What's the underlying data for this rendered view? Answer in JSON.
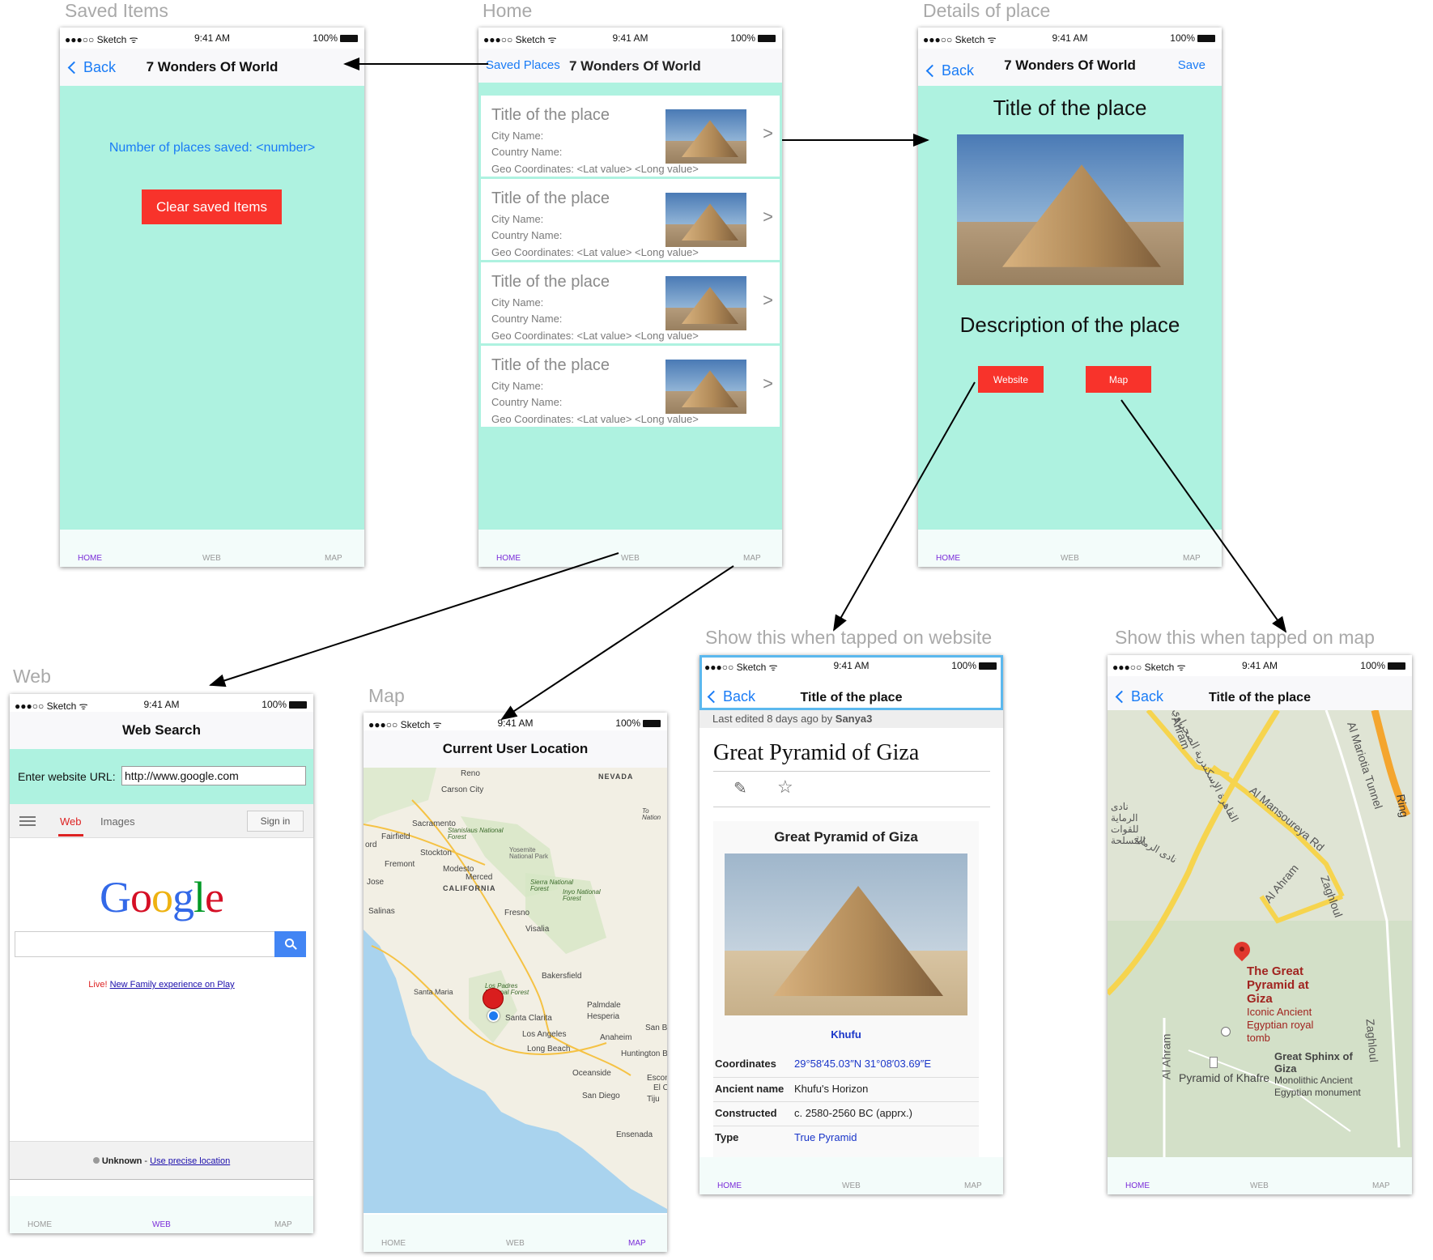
{
  "screens": {
    "saved": {
      "label": "Saved Items",
      "status": {
        "carrier": "●●●○○ Sketch ᯤ",
        "time": "9:41 AM",
        "battery": "100%"
      },
      "back": "Back",
      "title": "7 Wonders Of World",
      "count_text": "Number of places saved: <number>",
      "clear_button": "Clear saved Items"
    },
    "home": {
      "label": "Home",
      "status": {
        "carrier": "●●●○○ Sketch ᯤ",
        "time": "9:41 AM",
        "battery": "100%"
      },
      "saved_places": "Saved Places",
      "title": "7 Wonders Of World",
      "cards": [
        {
          "title": "Title of the place",
          "city": "City Name:",
          "country": "Country Name:",
          "geo": "Geo Coordinates: <Lat value> <Long value>",
          "arrow": ">"
        },
        {
          "title": "Title of the place",
          "city": "City Name:",
          "country": "Country Name:",
          "geo": "Geo Coordinates: <Lat value> <Long value>",
          "arrow": ">"
        },
        {
          "title": "Title of the place",
          "city": "City Name:",
          "country": "Country Name:",
          "geo": "Geo Coordinates: <Lat value> <Long value>",
          "arrow": ">"
        },
        {
          "title": "Title of the place",
          "city": "City Name:",
          "country": "Country Name:",
          "geo": "Geo Coordinates: <Lat value> <Long value>",
          "arrow": ">"
        }
      ]
    },
    "details": {
      "label": "Details of place",
      "status": {
        "carrier": "●●●○○ Sketch ᯤ",
        "time": "9:41 AM",
        "battery": "100%"
      },
      "back": "Back",
      "title": "7 Wonders Of World",
      "save": "Save",
      "place_title": "Title of the place",
      "description": "Description of the place",
      "website_button": "Website",
      "map_button": "Map"
    },
    "web": {
      "label": "Web",
      "status": {
        "carrier": "●●●○○ Sketch ᯤ",
        "time": "9:41 AM",
        "battery": "100%"
      },
      "title": "Web Search",
      "url_label": "Enter website URL:",
      "url_value": "http://www.google.com",
      "google": {
        "tab_web": "Web",
        "tab_images": "Images",
        "sign_in": "Sign in",
        "logo": "Google",
        "promo_live": "Live!",
        "promo_link": "New Family experience on Play",
        "location_unknown": "Unknown",
        "location_dash": " - ",
        "location_link": "Use precise location"
      }
    },
    "map": {
      "label": "Map",
      "status": {
        "carrier": "●●●○○ Sketch ᯤ",
        "time": "9:41 AM",
        "battery": "100%"
      },
      "title": "Current User Location",
      "places": [
        "Reno",
        "Carson City",
        "NEVADA",
        "Sacramento",
        "Fairfield",
        "Stanislaus National Forest",
        "Yosemite National Park",
        "Stockton",
        "Fremont",
        "Modesto",
        "Merced",
        "Jose",
        "CALIFORNIA",
        "Sierra National Forest",
        "Inyo National Forest",
        "Salinas",
        "Fresno",
        "Visalia",
        "Bakersfield",
        "Santa Maria",
        "Los Padres National Forest",
        "Palmdale",
        "Santa Clarita",
        "Hesperia",
        "San Ber",
        "Los Angeles",
        "Anaheim",
        "Long Beach",
        "Huntington Bea",
        "Oceanside",
        "Escon",
        "El C",
        "San Diego",
        "Tiju",
        "Ensenada",
        "To Nation",
        "ord"
      ]
    },
    "wiki": {
      "label": "Show this when tapped on website",
      "status": {
        "carrier": "●●●○○ Sketch ᯤ",
        "time": "9:41 AM",
        "battery": "100%"
      },
      "back": "Back",
      "title": "Title of the place",
      "edited_prefix": "Last edited 8 days ago by ",
      "edited_user": "Sanya3",
      "heading": "Great Pyramid of Giza",
      "infobox_title": "Great Pyramid of Giza",
      "caption": "Khufu",
      "rows": [
        {
          "k": "Coordinates",
          "v": "29°58′45.03″N 31°08′03.69″E"
        },
        {
          "k": "Ancient name",
          "v": "Khufu's Horizon"
        },
        {
          "k": "Constructed",
          "v": "c. 2580-2560 BC (apprx.)"
        },
        {
          "k": "Type",
          "v": "True Pyramid"
        }
      ]
    },
    "gmap": {
      "label": "Show this when tapped on map",
      "status": {
        "carrier": "●●●○○ Sketch ᯤ",
        "time": "9:41 AM",
        "battery": "100%"
      },
      "back": "Back",
      "title": "Title of the place",
      "labels": {
        "road1": "Al Mansoureya Rd",
        "road2": "Al Ahram",
        "road3": "Al Mariotia Tunnel",
        "road4": "Zaghloul",
        "road5": "Zaghloul",
        "road6": "Al Ahram",
        "road7": "Ahram",
        "road8": "Ring",
        "arabic1": "نادى الرماية للقوات المسلحة",
        "arabic2": "نادى الرماية",
        "arabic3": "القاهرة الإسكندرية الصحراوي",
        "pyramid_title": "The Great Pyramid at Giza",
        "pyramid_sub": "Iconic Ancient Egyptian royal tomb",
        "sphinx_title": "Great Sphinx of Giza",
        "sphinx_sub": "Monolithic Ancient Egyptian monument",
        "khafre": "Pyramid of Khafre"
      }
    }
  },
  "tabs": {
    "home": "HOME",
    "web": "WEB",
    "map": "MAP"
  },
  "colors": {
    "mint": "#aef2e0",
    "red": "#f8332b",
    "ios_blue": "#1a7cf6",
    "tab_active": "#7a2bd9"
  }
}
